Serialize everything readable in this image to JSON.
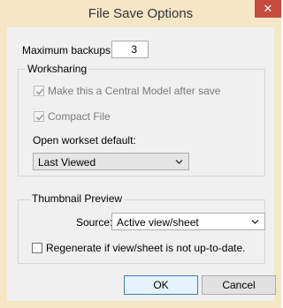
{
  "window": {
    "title": "File Save Options",
    "close_glyph": "✕"
  },
  "max_backups": {
    "label": "Maximum backups:",
    "value": "3"
  },
  "worksharing": {
    "legend": "Worksharing",
    "central_model": {
      "label": "Make this a Central Model after save",
      "checked": true,
      "enabled": false
    },
    "compact_file": {
      "label": "Compact File",
      "checked": true,
      "enabled": false
    },
    "open_workset_label": "Open workset default:",
    "open_workset_value": "Last Viewed"
  },
  "thumbnail": {
    "legend": "Thumbnail Preview",
    "source_label": "Source:",
    "source_value": "Active view/sheet",
    "regenerate": {
      "label": "Regenerate if view/sheet is not up-to-date.",
      "checked": false
    }
  },
  "buttons": {
    "ok": "OK",
    "cancel": "Cancel"
  },
  "icons": {
    "close": "close-icon",
    "check": "checkmark-icon",
    "dropdown": "chevron-down-icon"
  },
  "colors": {
    "title_bar": "#f6e6c8",
    "close_button": "#c74a3f",
    "default_button_border": "#3c7fb1"
  }
}
